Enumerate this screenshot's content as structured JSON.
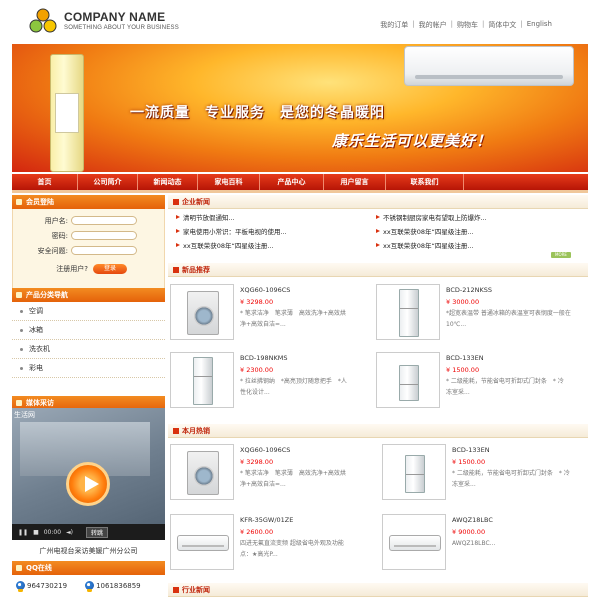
{
  "header": {
    "company_name": "COMPANY NAME",
    "tagline": "SOMETHING ABOUT YOUR BUSINESS",
    "top_links": [
      "我的订单",
      "我的帐户",
      "购物车",
      "简体中文",
      "English"
    ],
    "logo_colors": [
      "#f2a100",
      "#8cc63f",
      "#f7c600"
    ]
  },
  "banner": {
    "slogan_main": "一流质量　专业服务　是您的冬晶暖阳",
    "slogan_script": "康乐生活可以更美好！"
  },
  "nav": [
    "首页",
    "公司简介",
    "新闻动态",
    "家电百科",
    "产品中心",
    "用户留言",
    "联系我们"
  ],
  "login": {
    "title": "会员登陆",
    "username_label": "用户名:",
    "password_label": "密码:",
    "question_label": "安全问题:",
    "register_label": "注册用户?",
    "login_button": "登录"
  },
  "categories": {
    "title": "产品分类导航",
    "items": [
      "空调",
      "冰箱",
      "洗衣机",
      "彩电"
    ]
  },
  "video": {
    "title": "媒体采访",
    "label": "生活网",
    "time": "00:00",
    "go_label": "转跳",
    "caption": "广州电视台采访美媛广州分公司"
  },
  "qq": {
    "title": "QQ在线",
    "numbers": [
      "964730219",
      "1061836859"
    ]
  },
  "news": {
    "title": "企业新闻",
    "items": [
      "清明节放假通知...",
      "不锈钢制厨房家电有望取上防爆炸...",
      "家电使用小常识：平板电视的使用...",
      "xx互联荣获08年“四星级注册...",
      "xx互联荣获08年“四星级注册...",
      "xx互联荣获08年“四星级注册..."
    ],
    "more_label": "MORE"
  },
  "new_products": {
    "title": "新品推荐",
    "items": [
      {
        "name": "XQG60-1096CS",
        "price": "¥ 3298.00",
        "desc": "* 笔求洁净　笔求薄　高效洗净+高效烘净+高效自洁=...",
        "kind": "washer"
      },
      {
        "name": "BCD-212NKSS",
        "price": "¥ 3000.00",
        "desc": "*超宽表温带 普通冰箱的表温室可表悯度一般在10℃...",
        "kind": "fridge"
      },
      {
        "name": "BCD-198NKMS",
        "price": "¥ 2300.00",
        "desc": "* 拉丝拂钢纳　*高亮顶灯随意把手　*人性化设计...",
        "kind": "fridge"
      },
      {
        "name": "BCD-133EN",
        "price": "¥ 1500.00",
        "desc": "* 二级能耗，节能省电可折卸式门封条　* 冷冻室采...",
        "kind": "fridge"
      }
    ]
  },
  "hot_products": {
    "title": "本月热销",
    "items": [
      {
        "name": "XQG60-1096CS",
        "price": "¥ 3298.00",
        "desc": "* 笔求洁净　笔求薄　高效洗净+高效烘净+高效自洁=...",
        "kind": "washer"
      },
      {
        "name": "BCD-133EN",
        "price": "¥ 1500.00",
        "desc": "* 二级能耗，节能省电可折卸式门封条　* 冷冻室采...",
        "kind": "fridge"
      },
      {
        "name": "KFR-35GW/01ZE",
        "price": "¥ 2600.00",
        "desc": "四进无氟直流变频 超级省电外观及功能点：★高光P...",
        "kind": "ac"
      },
      {
        "name": "AWQZ18LBC",
        "price": "¥ 9000.00",
        "desc": "AWQZ18LBC...",
        "kind": "ac"
      }
    ]
  },
  "industry": {
    "title": "行业新闻"
  }
}
